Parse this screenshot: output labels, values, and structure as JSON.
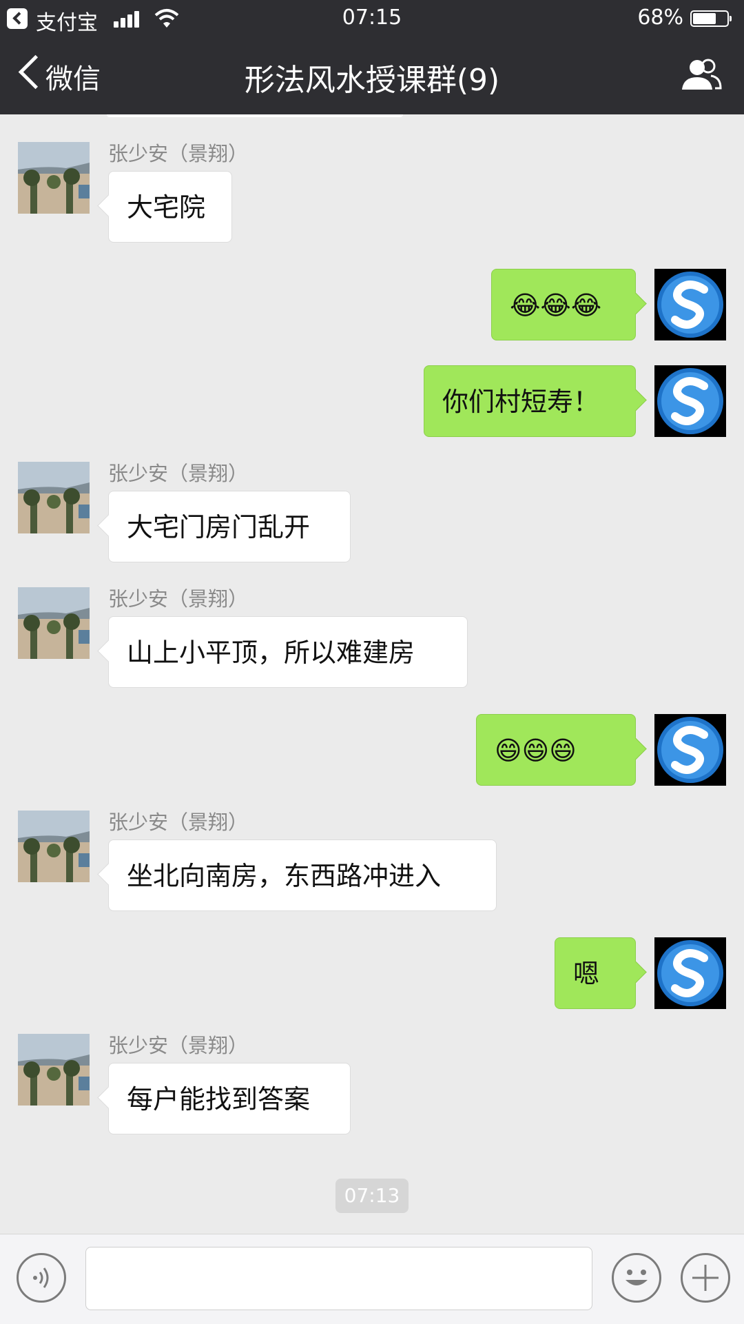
{
  "status_bar": {
    "back_app": "支付宝",
    "time": "07:15",
    "battery_percent": "68%",
    "battery_level": 0.68
  },
  "nav": {
    "back_label": "微信",
    "title": "形法风水授课群(9)",
    "group_icon": "group-members-icon"
  },
  "messages": [
    {
      "direction": "in",
      "sender": "张少安（景翔）",
      "text": "大宅院"
    },
    {
      "direction": "out",
      "text": "😂😂😂"
    },
    {
      "direction": "out",
      "text": "你们村短寿！"
    },
    {
      "direction": "in",
      "sender": "张少安（景翔）",
      "text": "大宅门房门乱开"
    },
    {
      "direction": "in",
      "sender": "张少安（景翔）",
      "text": "山上小平顶，所以难建房"
    },
    {
      "direction": "out",
      "text": "😄😄😄"
    },
    {
      "direction": "in",
      "sender": "张少安（景翔）",
      "text": "坐北向南房，东西路冲进入"
    },
    {
      "direction": "out",
      "text": "嗯"
    },
    {
      "direction": "in",
      "sender": "张少安（景翔）",
      "text": "每户能找到答案"
    }
  ],
  "timestamp": "07:13",
  "input_bar": {
    "voice_icon": "voice-icon",
    "input_value": "",
    "emoji_icon": "emoji-icon",
    "plus_icon": "plus-icon"
  },
  "colors": {
    "header_bg": "#2e2e32",
    "chat_bg": "#ebebeb",
    "outgoing_bubble": "#a0e75a",
    "incoming_bubble": "#ffffff"
  }
}
